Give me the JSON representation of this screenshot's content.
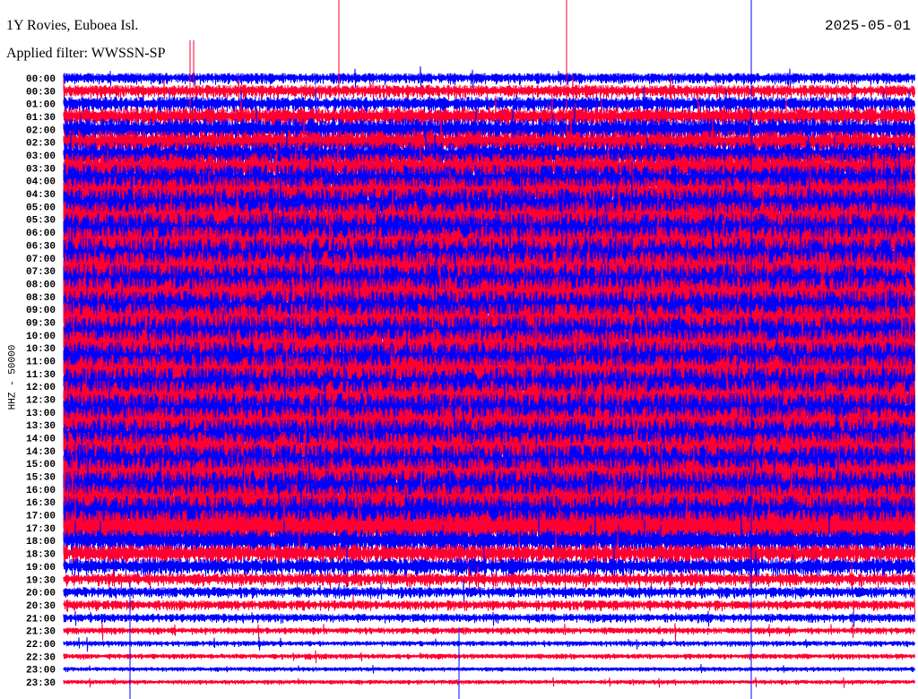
{
  "chart_data": {
    "type": "line",
    "subtype": "helicorder",
    "title": "1Y Rovies, Euboea Isl.",
    "subtitle": "Applied filter: WWSSN-SP",
    "date": "2025-05-01",
    "ylabel": "HHZ - 50000",
    "row_labels": [
      "00:00",
      "00:30",
      "01:00",
      "01:30",
      "02:00",
      "02:30",
      "03:00",
      "03:30",
      "04:00",
      "04:30",
      "05:00",
      "05:30",
      "06:00",
      "06:30",
      "07:00",
      "07:30",
      "08:00",
      "08:30",
      "09:00",
      "09:30",
      "10:00",
      "10:30",
      "11:00",
      "11:30",
      "12:00",
      "12:30",
      "13:00",
      "13:30",
      "14:00",
      "14:30",
      "15:00",
      "15:30",
      "16:00",
      "16:30",
      "17:00",
      "17:30",
      "18:00",
      "18:30",
      "19:00",
      "19:30",
      "20:00",
      "20:30",
      "21:00",
      "21:30",
      "22:00",
      "22:30",
      "23:00",
      "23:30"
    ],
    "relative_amplitude": [
      0.5,
      0.6,
      0.7,
      0.9,
      1.1,
      1.2,
      1.3,
      1.5,
      1.6,
      1.7,
      1.8,
      1.8,
      1.9,
      1.9,
      2.0,
      2.0,
      2.0,
      2.0,
      1.9,
      1.9,
      1.9,
      1.9,
      1.9,
      1.9,
      1.9,
      1.9,
      1.9,
      1.9,
      1.9,
      1.9,
      1.9,
      1.9,
      1.9,
      1.9,
      1.9,
      1.8,
      1.1,
      0.9,
      0.8,
      0.6,
      0.5,
      0.45,
      0.4,
      0.3,
      0.25,
      0.25,
      0.2,
      0.2
    ],
    "colors": [
      "#0000ff",
      "#ff0033"
    ]
  }
}
